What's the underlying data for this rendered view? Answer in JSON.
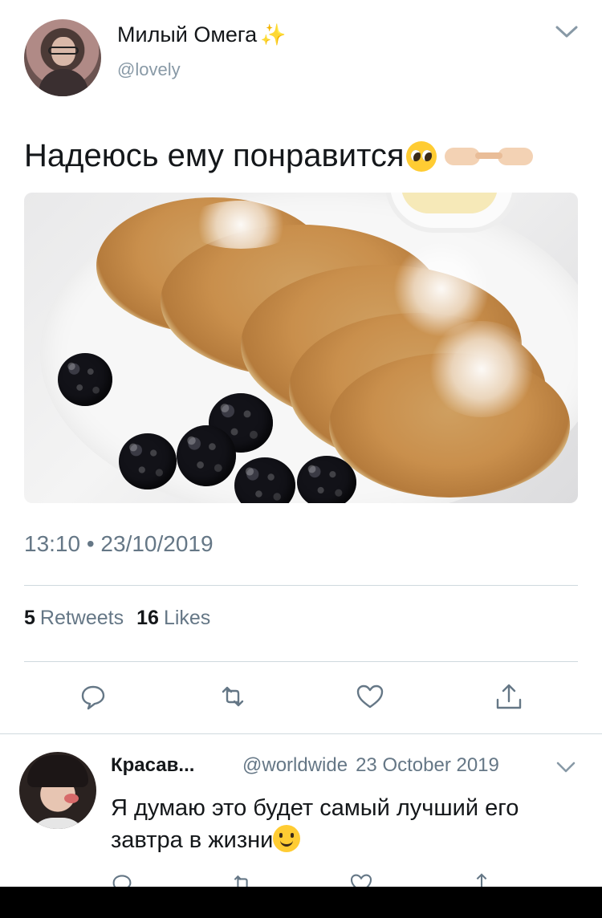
{
  "tweet": {
    "author_name": "Милый Омега",
    "author_name_emoji": "✨",
    "author_handle": "@lovely",
    "text": "Надеюсь ему понравится",
    "text_emojis": [
      "pleading-face-emoji",
      "hand-pointing-right-icon",
      "hand-pointing-left-icon"
    ],
    "timestamp": "13:10 • 23/10/2019",
    "retweets_count": "5",
    "retweets_label": "Retweets",
    "likes_count": "16",
    "likes_label": "Likes",
    "actions": [
      "reply-icon",
      "retweet-icon",
      "like-icon",
      "share-icon"
    ]
  },
  "reply": {
    "author_name": "Красав...",
    "author_handle": "@worldwide",
    "date": "23 October 2019",
    "text": "Я думаю это будет самый лучший его завтра в жизни",
    "text_emoji": "slightly-smiling-face-emoji"
  },
  "colors": {
    "text_primary": "#14171a",
    "text_secondary": "#657786",
    "divider": "#cfd9de",
    "background": "#ffffff"
  }
}
